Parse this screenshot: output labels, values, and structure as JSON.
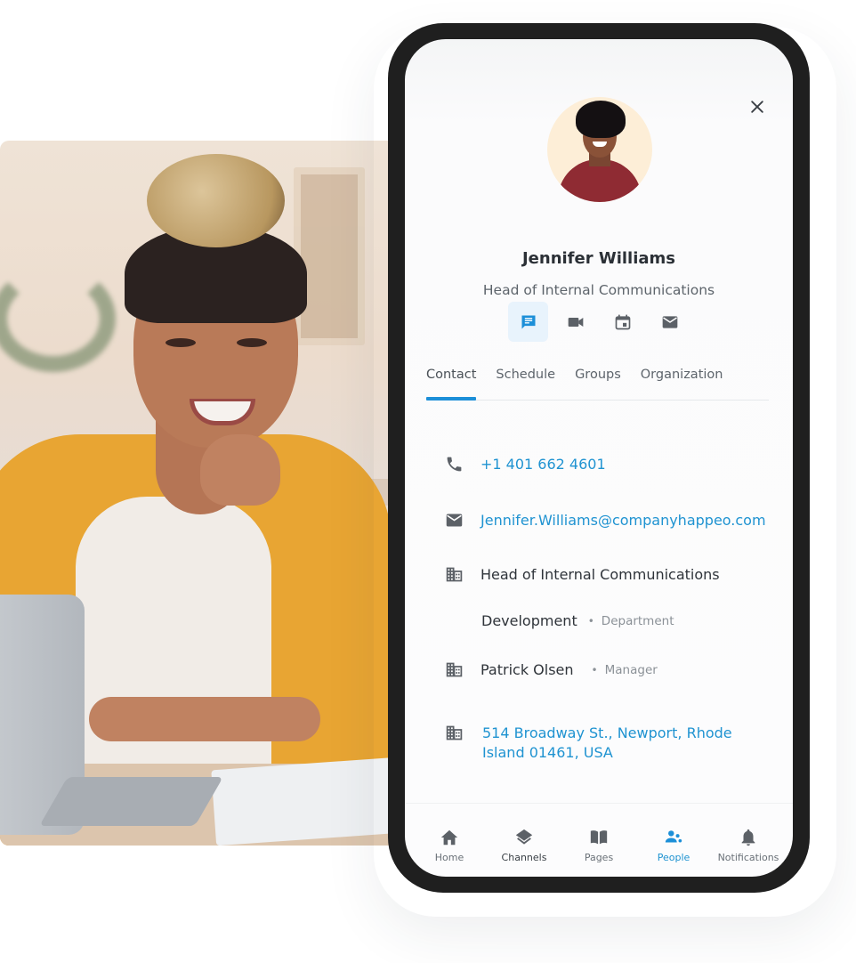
{
  "colors": {
    "accent": "#1c8fd8",
    "link": "#1f93d1",
    "icon": "#5c6167",
    "frame": "#1f1f1f",
    "avatar_bg": "#fdeed7"
  },
  "profile": {
    "name": "Jennifer Williams",
    "title": "Head of Internal Communications",
    "close_icon": "close-icon"
  },
  "actions": [
    {
      "name": "chat",
      "icon": "chat-icon",
      "active": true
    },
    {
      "name": "video-call",
      "icon": "video-icon",
      "active": false
    },
    {
      "name": "calendar",
      "icon": "calendar-icon",
      "active": false
    },
    {
      "name": "email",
      "icon": "mail-icon",
      "active": false
    }
  ],
  "tabs": [
    {
      "label": "Contact",
      "active": true
    },
    {
      "label": "Schedule",
      "active": false
    },
    {
      "label": "Groups",
      "active": false
    },
    {
      "label": "Organization",
      "active": false
    }
  ],
  "contact": {
    "phone": "+1 401 662 4601",
    "email": "Jennifer.Williams@companyhappeo.com",
    "role": "Head of Internal Communications",
    "department": {
      "value": "Development",
      "label": "Department"
    },
    "manager": {
      "value": "Patrick Olsen",
      "label": "Manager"
    },
    "address": "514 Broadway St., Newport, Rhode Island 01461, USA"
  },
  "bottom_nav": [
    {
      "label": "Home",
      "icon": "home-icon",
      "active": false
    },
    {
      "label": "Channels",
      "icon": "layers-icon",
      "active": false
    },
    {
      "label": "Pages",
      "icon": "book-icon",
      "active": false
    },
    {
      "label": "People",
      "icon": "people-icon",
      "active": true
    },
    {
      "label": "Notifications",
      "icon": "bell-icon",
      "active": false
    }
  ]
}
